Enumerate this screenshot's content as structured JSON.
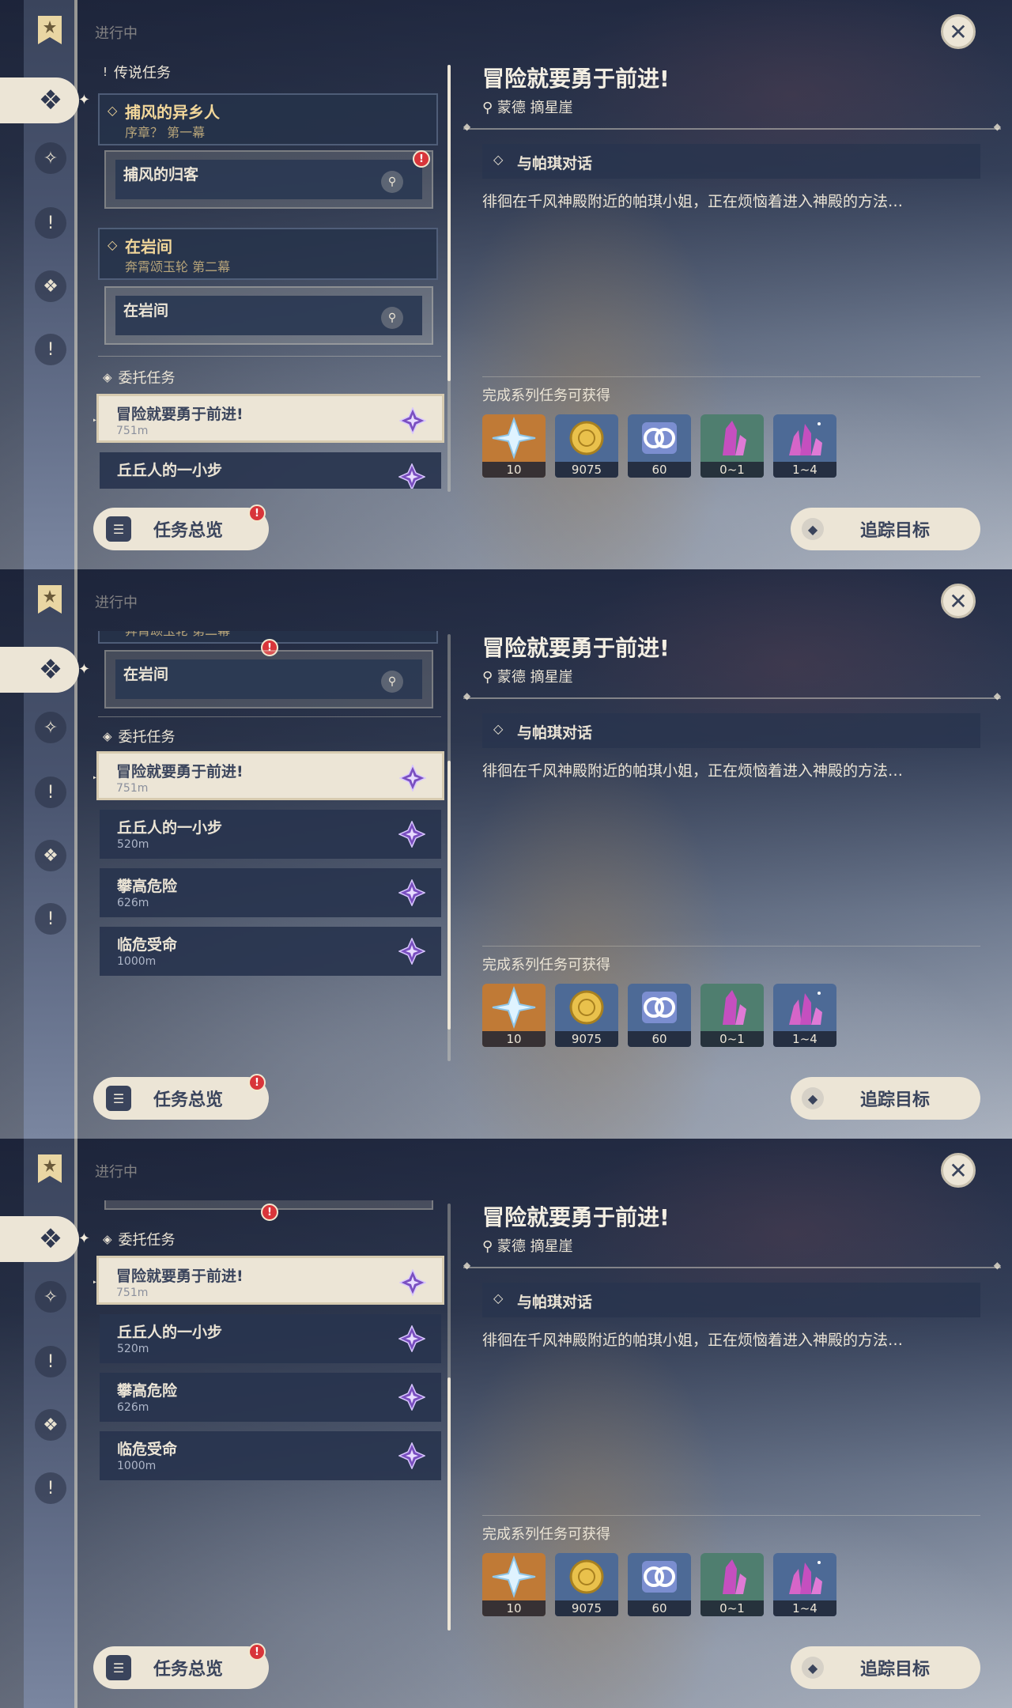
{
  "header": {
    "section_title": "进行中"
  },
  "legend_quests": {
    "group_label": "传说任务",
    "quests": [
      {
        "title": "捕风的异乡人",
        "subtitle": "序章？ 第一幕",
        "step": "捕风的归客"
      },
      {
        "title": "在岩间",
        "subtitle": "奔霄颂玉轮 第二幕",
        "step": "在岩间"
      }
    ]
  },
  "commissions": {
    "group_label": "委托任务",
    "items": [
      {
        "title": "冒险就要勇于前进!",
        "distance": "751m"
      },
      {
        "title": "丘丘人的一小步",
        "distance": "520m"
      },
      {
        "title": "攀高危险",
        "distance": "626m"
      },
      {
        "title": "临危受命",
        "distance": "1000m"
      }
    ]
  },
  "detail": {
    "title": "冒险就要勇于前进!",
    "location": "蒙德 摘星崖",
    "objective": "与帕琪对话",
    "description": "徘徊在千风神殿附近的帕琪小姐，正在烦恼着进入神殿的方法…",
    "rewards_label": "完成系列任务可获得",
    "rewards": [
      {
        "icon": "primogem-icon",
        "count": "10",
        "bg": "#c07a36"
      },
      {
        "icon": "mora-icon",
        "count": "9075",
        "bg": "#4d6a96"
      },
      {
        "icon": "adventure-exp-icon",
        "count": "60",
        "bg": "#4d6a96"
      },
      {
        "icon": "crystal-chunk-icon",
        "count": "0~1",
        "bg": "#4f7e6f"
      },
      {
        "icon": "crystal-cluster-icon",
        "count": "1~4",
        "bg": "#4d6a96"
      }
    ]
  },
  "buttons": {
    "overview": "任务总览",
    "track": "追踪目标",
    "alert_mark": "!"
  },
  "icons": {
    "close": "close-icon",
    "sidebar": [
      "bookmark-icon",
      "all-quests-icon",
      "archon-quest-icon",
      "story-quest-icon",
      "world-quest-icon",
      "event-quest-icon"
    ]
  }
}
